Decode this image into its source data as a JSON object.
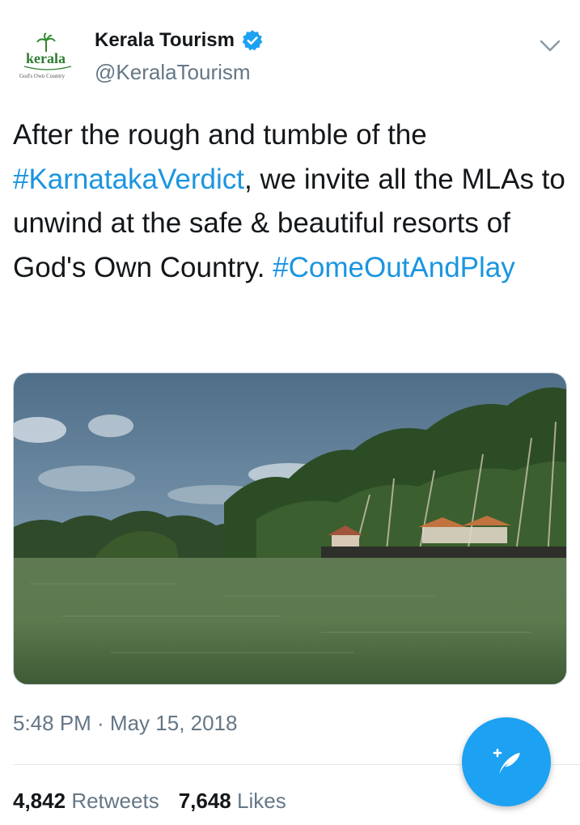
{
  "header": {
    "display_name": "Kerala Tourism",
    "handle": "@KeralaTourism",
    "logo_text": "kerala",
    "logo_tagline": "God's Own Country",
    "verified_icon": "verified-badge-icon",
    "menu_icon": "chevron-down-icon"
  },
  "tweet": {
    "text_part1": "After the rough and tumble of the ",
    "hashtag1": "#KarnatakaVerdict",
    "text_part2": ", we invite all the MLAs to unwind at the safe & beautiful resorts of God's Own Country. ",
    "hashtag2": "#ComeOutAndPlay"
  },
  "meta": {
    "timestamp": "5:48 PM · May 15, 2018"
  },
  "stats": {
    "retweets_count": "4,842",
    "retweets_label": "Retweets",
    "likes_count": "7,648",
    "likes_label": "Likes"
  },
  "fab": {
    "icon": "compose-tweet-icon"
  },
  "colors": {
    "link": "#1b95e0",
    "fab": "#1da1f2",
    "secondary_text": "#657786"
  }
}
